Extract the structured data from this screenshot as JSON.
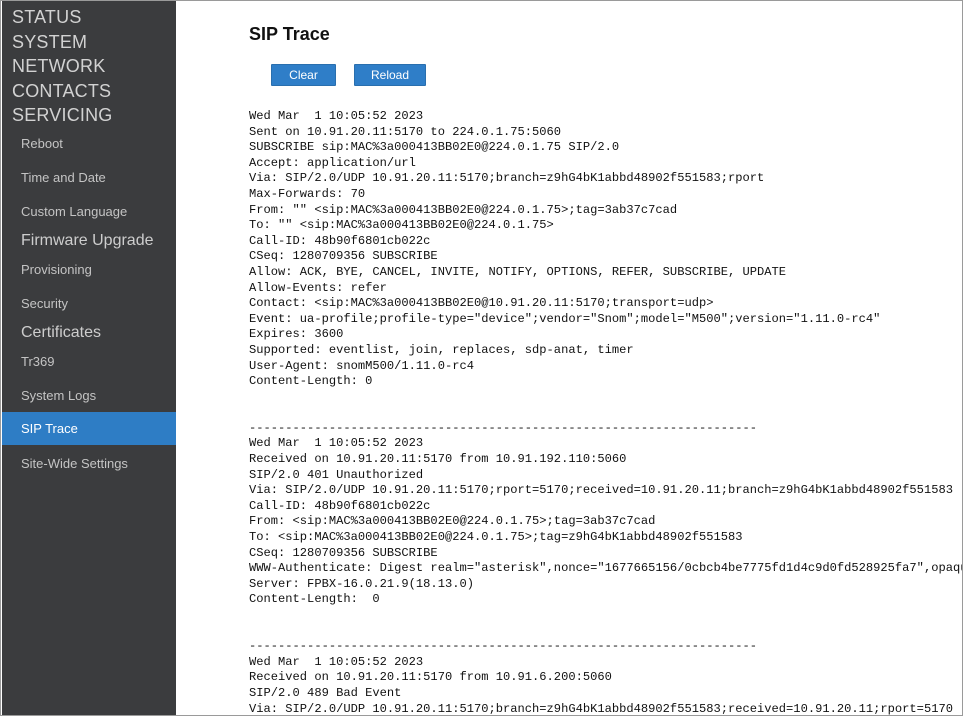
{
  "sidebar": {
    "main": [
      "STATUS",
      "SYSTEM",
      "NETWORK",
      "CONTACTS",
      "SERVICING"
    ],
    "sub": [
      {
        "label": "Reboot"
      },
      {
        "label": "Time and Date"
      },
      {
        "label": "Custom Language"
      },
      {
        "label": "Firmware Upgrade"
      },
      {
        "label": "Provisioning"
      },
      {
        "label": "Security"
      },
      {
        "label": "Certificates"
      },
      {
        "label": "Tr369"
      },
      {
        "label": "System Logs"
      },
      {
        "label": "SIP Trace"
      },
      {
        "label": "Site-Wide Settings"
      }
    ],
    "active": "SIP Trace"
  },
  "page": {
    "title": "SIP Trace",
    "clear_label": "Clear",
    "reload_label": "Reload"
  },
  "trace": "Wed Mar  1 10:05:52 2023\nSent on 10.91.20.11:5170 to 224.0.1.75:5060\nSUBSCRIBE sip:MAC%3a000413BB02E0@224.0.1.75 SIP/2.0\nAccept: application/url\nVia: SIP/2.0/UDP 10.91.20.11:5170;branch=z9hG4bK1abbd48902f551583;rport\nMax-Forwards: 70\nFrom: \"\" <sip:MAC%3a000413BB02E0@224.0.1.75>;tag=3ab37c7cad\nTo: \"\" <sip:MAC%3a000413BB02E0@224.0.1.75>\nCall-ID: 48b90f6801cb022c\nCSeq: 1280709356 SUBSCRIBE\nAllow: ACK, BYE, CANCEL, INVITE, NOTIFY, OPTIONS, REFER, SUBSCRIBE, UPDATE\nAllow-Events: refer\nContact: <sip:MAC%3a000413BB02E0@10.91.20.11:5170;transport=udp>\nEvent: ua-profile;profile-type=\"device\";vendor=\"Snom\";model=\"M500\";version=\"1.11.0-rc4\"\nExpires: 3600\nSupported: eventlist, join, replaces, sdp-anat, timer\nUser-Agent: snomM500/1.11.0-rc4\nContent-Length: 0\n\n\n----------------------------------------------------------------------\nWed Mar  1 10:05:52 2023\nReceived on 10.91.20.11:5170 from 10.91.192.110:5060\nSIP/2.0 401 Unauthorized\nVia: SIP/2.0/UDP 10.91.20.11:5170;rport=5170;received=10.91.20.11;branch=z9hG4bK1abbd48902f551583\nCall-ID: 48b90f6801cb022c\nFrom: <sip:MAC%3a000413BB02E0@224.0.1.75>;tag=3ab37c7cad\nTo: <sip:MAC%3a000413BB02E0@224.0.1.75>;tag=z9hG4bK1abbd48902f551583\nCSeq: 1280709356 SUBSCRIBE\nWWW-Authenticate: Digest realm=\"asterisk\",nonce=\"1677665156/0cbcb4be7775fd1d4c9d0fd528925fa7\",opaque=\"\nServer: FPBX-16.0.21.9(18.13.0)\nContent-Length:  0\n\n\n----------------------------------------------------------------------\nWed Mar  1 10:05:52 2023\nReceived on 10.91.20.11:5170 from 10.91.6.200:5060\nSIP/2.0 489 Bad Event\nVia: SIP/2.0/UDP 10.91.20.11:5170;branch=z9hG4bK1abbd48902f551583;received=10.91.20.11;rport=5170"
}
